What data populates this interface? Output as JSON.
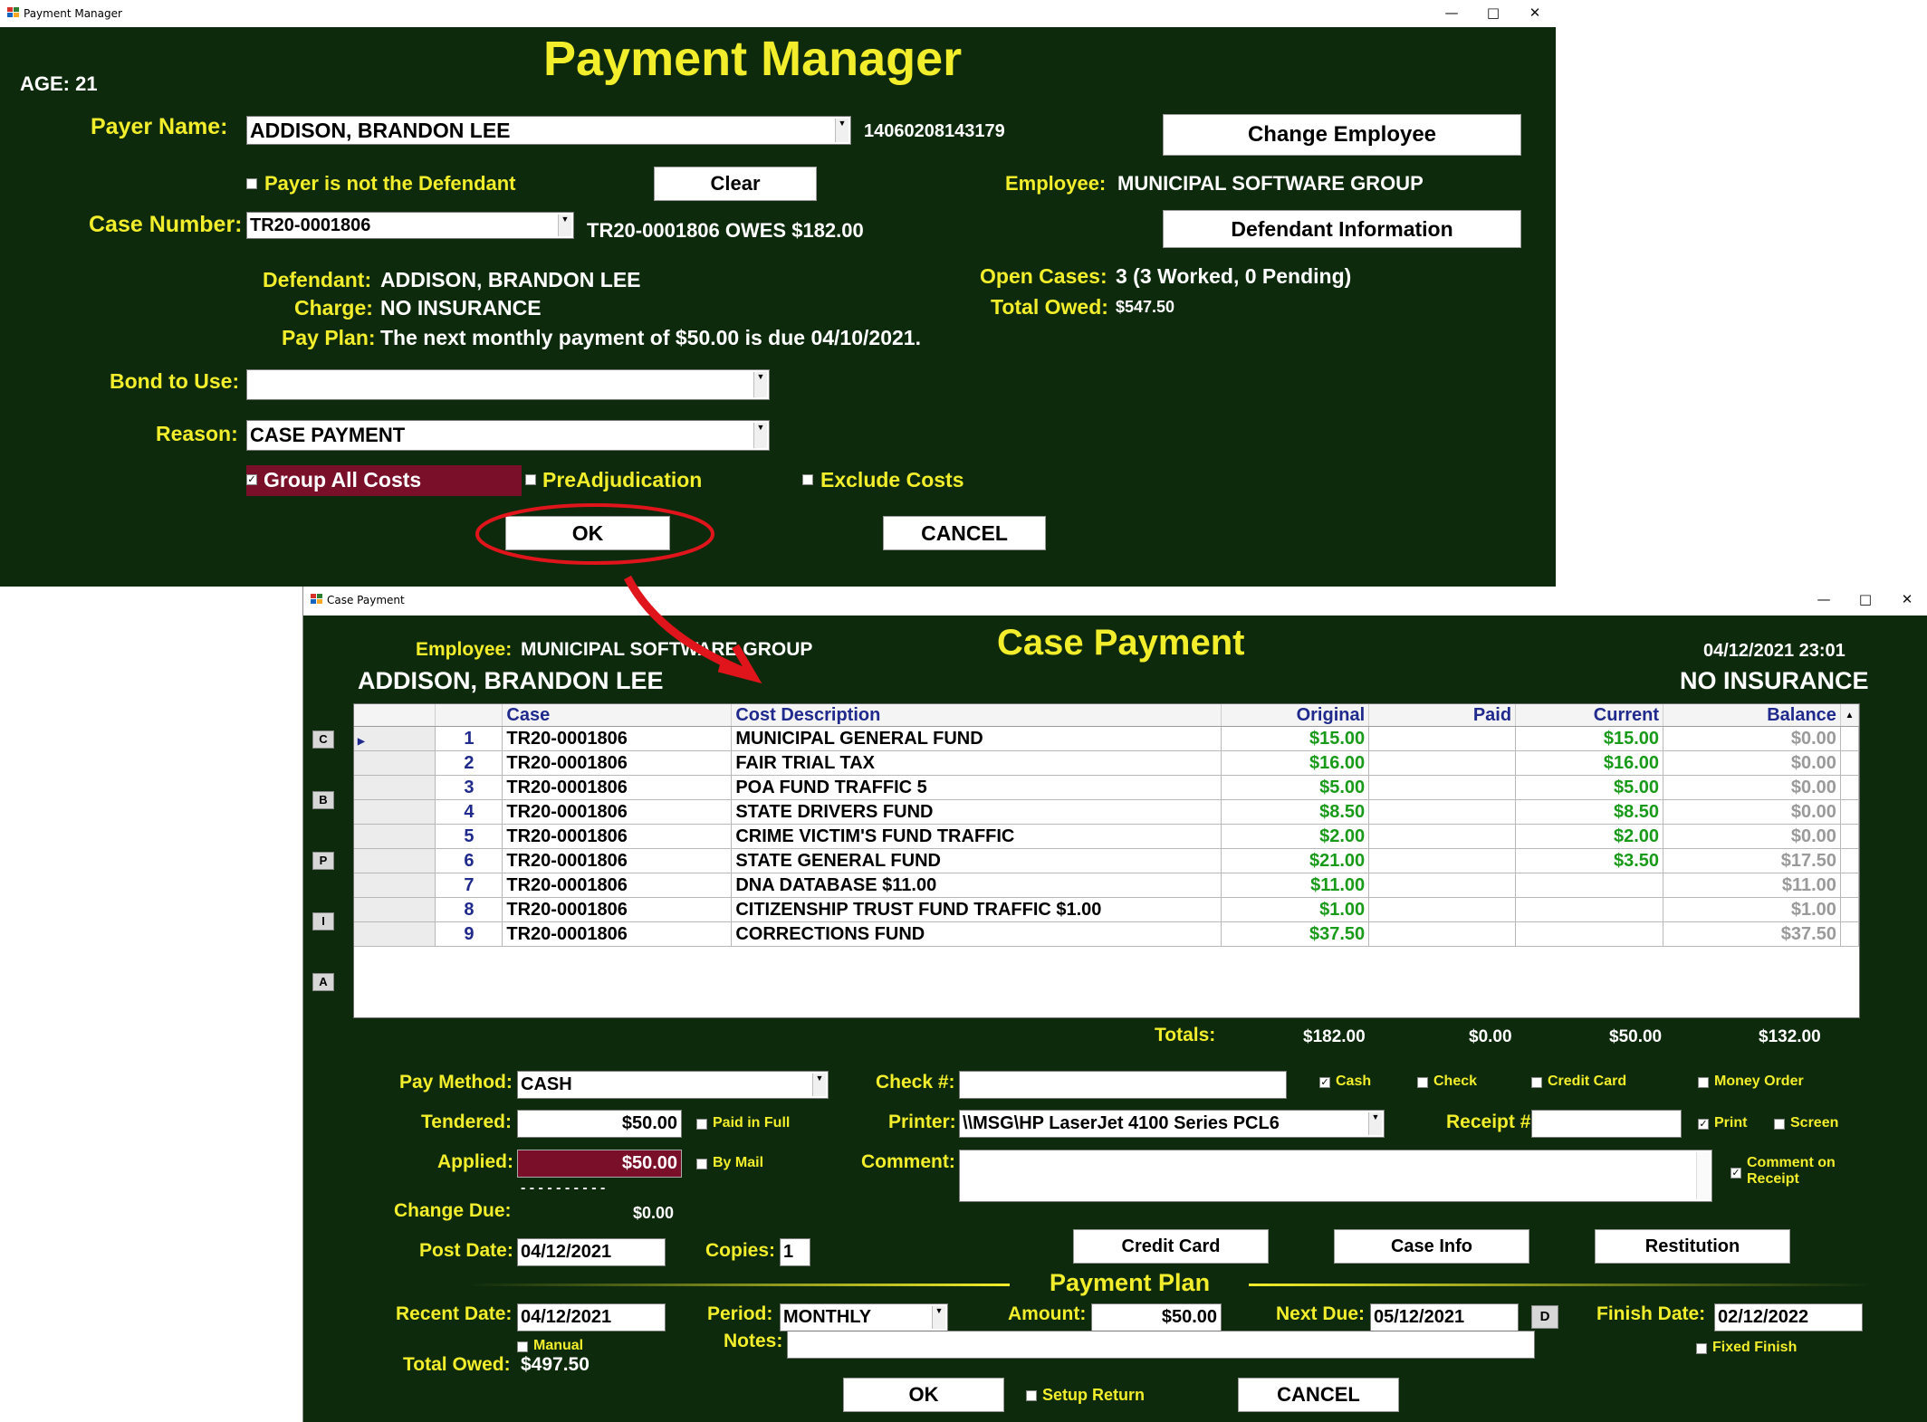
{
  "payment_manager": {
    "window_title": "Payment Manager",
    "title": "Payment Manager",
    "age": "AGE: 21",
    "payer_name_label": "Payer Name:",
    "payer_name_value": "ADDISON, BRANDON LEE",
    "payer_id": "14060208143179",
    "payer_not_defendant_label": "Payer is not the Defendant",
    "clear_label": "Clear",
    "change_employee_label": "Change Employee",
    "employee_label": "Employee:",
    "employee_value": "MUNICIPAL SOFTWARE GROUP",
    "case_number_label": "Case Number:",
    "case_number_value": "TR20-0001806",
    "case_owes": "TR20-0001806 OWES $182.00",
    "defendant_info_label": "Defendant Information",
    "defendant_label": "Defendant:",
    "defendant_value": "ADDISON, BRANDON LEE",
    "charge_label": "Charge:",
    "charge_value": "NO INSURANCE",
    "pay_plan_label": "Pay Plan:",
    "pay_plan_value": "The next monthly payment of $50.00 is due 04/10/2021.",
    "open_cases_label": "Open Cases:",
    "open_cases_value": "3 (3 Worked, 0 Pending)",
    "total_owed_label": "Total Owed:",
    "total_owed_value": "$547.50",
    "bond_label": "Bond to Use:",
    "bond_value": "",
    "reason_label": "Reason:",
    "reason_value": "CASE PAYMENT",
    "group_all_costs_label": "Group All Costs",
    "preadjudication_label": "PreAdjudication",
    "exclude_costs_label": "Exclude Costs",
    "ok_label": "OK",
    "cancel_label": "CANCEL"
  },
  "case_payment": {
    "window_title": "Case Payment",
    "title": "Case Payment",
    "employee_label": "Employee:",
    "employee_value": "MUNICIPAL SOFTWARE GROUP",
    "defendant_name": "ADDISON, BRANDON LEE",
    "datetime": "04/12/2021 23:01",
    "charge": "NO INSURANCE",
    "side_buttons": [
      "C",
      "B",
      "P",
      "I",
      "A"
    ],
    "columns": [
      "Case",
      "Cost Description",
      "Original",
      "Paid",
      "Current",
      "Balance"
    ],
    "rows": [
      {
        "n": "1",
        "case": "TR20-0001806",
        "desc": "MUNICIPAL GENERAL FUND",
        "original": "$15.00",
        "paid": "",
        "current": "$15.00",
        "balance": "$0.00"
      },
      {
        "n": "2",
        "case": "TR20-0001806",
        "desc": "FAIR TRIAL TAX",
        "original": "$16.00",
        "paid": "",
        "current": "$16.00",
        "balance": "$0.00"
      },
      {
        "n": "3",
        "case": "TR20-0001806",
        "desc": "POA FUND TRAFFIC 5",
        "original": "$5.00",
        "paid": "",
        "current": "$5.00",
        "balance": "$0.00"
      },
      {
        "n": "4",
        "case": "TR20-0001806",
        "desc": "STATE DRIVERS FUND",
        "original": "$8.50",
        "paid": "",
        "current": "$8.50",
        "balance": "$0.00"
      },
      {
        "n": "5",
        "case": "TR20-0001806",
        "desc": "CRIME VICTIM'S FUND TRAFFIC",
        "original": "$2.00",
        "paid": "",
        "current": "$2.00",
        "balance": "$0.00"
      },
      {
        "n": "6",
        "case": "TR20-0001806",
        "desc": "STATE GENERAL FUND",
        "original": "$21.00",
        "paid": "",
        "current": "$3.50",
        "balance": "$17.50"
      },
      {
        "n": "7",
        "case": "TR20-0001806",
        "desc": "DNA DATABASE $11.00",
        "original": "$11.00",
        "paid": "",
        "current": "",
        "balance": "$11.00"
      },
      {
        "n": "8",
        "case": "TR20-0001806",
        "desc": "CITIZENSHIP TRUST FUND TRAFFIC $1.00",
        "original": "$1.00",
        "paid": "",
        "current": "",
        "balance": "$1.00"
      },
      {
        "n": "9",
        "case": "TR20-0001806",
        "desc": "CORRECTIONS FUND",
        "original": "$37.50",
        "paid": "",
        "current": "",
        "balance": "$37.50"
      }
    ],
    "totals_label": "Totals:",
    "totals": {
      "original": "$182.00",
      "paid": "$0.00",
      "current": "$50.00",
      "balance": "$132.00"
    },
    "pay_method_label": "Pay Method:",
    "pay_method_value": "CASH",
    "check_no_label": "Check #:",
    "check_no_value": "",
    "cash_label": "Cash",
    "check_label": "Check",
    "credit_card_cb_label": "Credit Card",
    "money_order_label": "Money Order",
    "tendered_label": "Tendered:",
    "tendered_value": "$50.00",
    "paid_in_full_label": "Paid in Full",
    "printer_label": "Printer:",
    "printer_value": "\\\\MSG\\HP LaserJet 4100 Series PCL6",
    "receipt_label": "Receipt #:",
    "receipt_value": "",
    "print_label": "Print",
    "screen_label": "Screen",
    "applied_label": "Applied:",
    "applied_value": "$50.00",
    "by_mail_label": "By Mail",
    "comment_label": "Comment:",
    "comment_value": "",
    "comment_on_receipt_label_1": "Comment on",
    "comment_on_receipt_label_2": "Receipt",
    "dashes": "- - - - - - - - - -",
    "change_due_label": "Change Due:",
    "change_due_value": "$0.00",
    "post_date_label": "Post Date:",
    "post_date_value": "04/12/2021",
    "copies_label": "Copies:",
    "copies_value": "1",
    "credit_card_btn_label": "Credit Card",
    "case_info_label": "Case Info",
    "restitution_label": "Restitution",
    "payment_plan_label": "Payment Plan",
    "recent_date_label": "Recent Date:",
    "recent_date_value": "04/12/2021",
    "period_label": "Period:",
    "period_value": "MONTHLY",
    "amount_label": "Amount:",
    "amount_value": "$50.00",
    "next_due_label": "Next Due:",
    "next_due_value": "05/12/2021",
    "d_label": "D",
    "finish_date_label": "Finish Date:",
    "finish_date_value": "02/12/2022",
    "manual_label": "Manual",
    "notes_label": "Notes:",
    "notes_value": "",
    "fixed_finish_label": "Fixed Finish",
    "total_owed_label": "Total Owed:",
    "total_owed_value": "$497.50",
    "ok_label": "OK",
    "setup_return_label": "Setup Return",
    "cancel_label": "CANCEL"
  },
  "colors": {
    "background": "#0d2a0d",
    "label_yellow": "#f2ee2b",
    "highlight_maroon": "#7a0f2a",
    "annotation_red": "#e0141b",
    "grid_green": "#1a9a1a",
    "grid_blue": "#1f2a8c"
  }
}
